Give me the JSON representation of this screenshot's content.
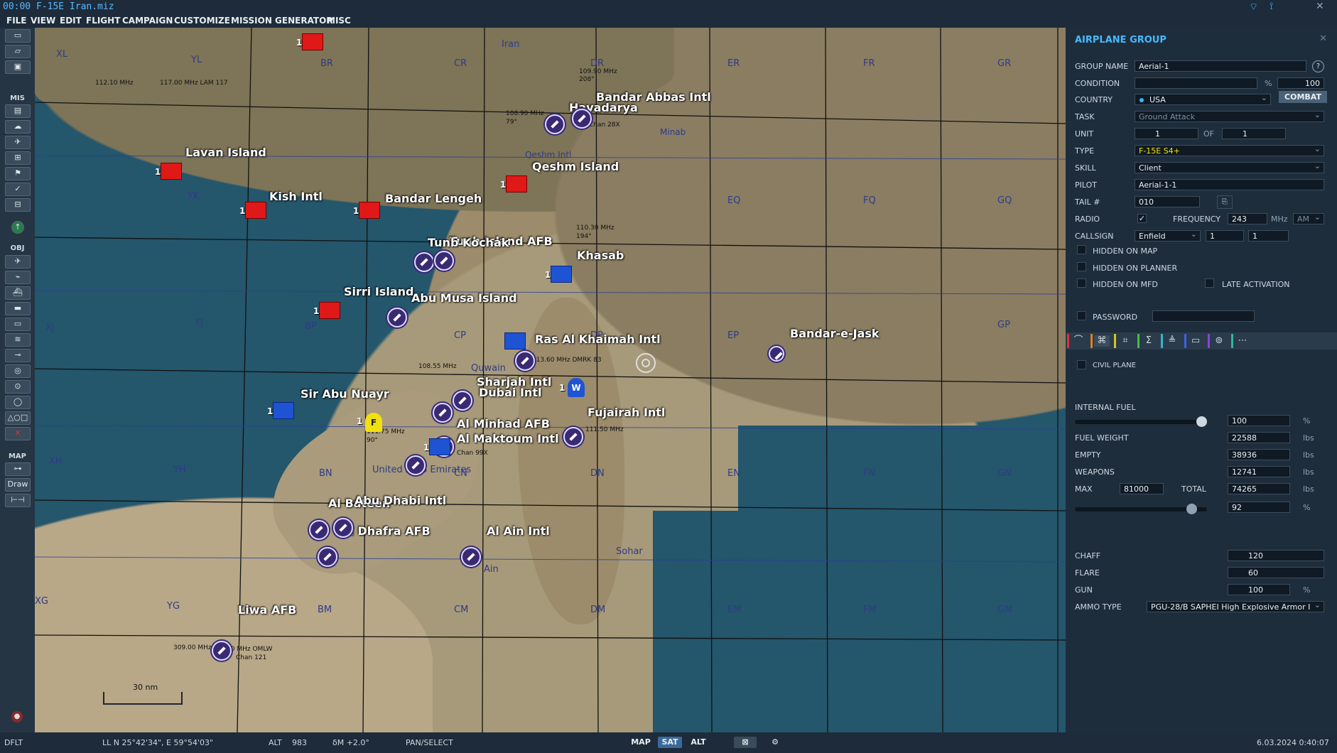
{
  "titlebar": {
    "title": "00:00 F-15E Iran.miz"
  },
  "menu": {
    "items": [
      "FILE",
      "VIEW",
      "EDIT",
      "FLIGHT",
      "CAMPAIGN",
      "CUSTOMIZE",
      "MISSION GENERATOR",
      "MISC"
    ]
  },
  "toolbar": {
    "sections": {
      "mis": "MIS",
      "obj": "OBJ",
      "map": "MAP"
    },
    "draw_label": "Draw"
  },
  "map": {
    "grid_labels": [
      "XL",
      "YL",
      "BR",
      "CR",
      "DR",
      "ER",
      "FR",
      "GR",
      "YK",
      "EQ",
      "FQ",
      "GQ",
      "XJ",
      "YJ",
      "BP",
      "CP",
      "DP",
      "EP",
      "FP",
      "GP",
      "XH",
      "YH",
      "BN",
      "CN",
      "DN",
      "EN",
      "FN",
      "GN",
      "XG",
      "YG",
      "ZG",
      "BM",
      "CM",
      "DM",
      "EM",
      "FM",
      "GM"
    ],
    "places": [
      {
        "name": "Bandar Abbas Intl"
      },
      {
        "name": "Havadarya"
      },
      {
        "name": "Lavan Island"
      },
      {
        "name": "Qeshm Island"
      },
      {
        "name": "Kish Intl"
      },
      {
        "name": "Bandar Lengeh"
      },
      {
        "name": "Tunb Island AFB"
      },
      {
        "name": "Tunb Kochak"
      },
      {
        "name": "Khasab"
      },
      {
        "name": "Sirri Island"
      },
      {
        "name": "Abu Musa Island"
      },
      {
        "name": "Ras Al Khaimah Intl"
      },
      {
        "name": "Bandar-e-Jask"
      },
      {
        "name": "Sharjah Intl"
      },
      {
        "name": "Dubai Intl"
      },
      {
        "name": "Sir Abu Nuayr"
      },
      {
        "name": "Fujairah Intl"
      },
      {
        "name": "Al Minhad AFB"
      },
      {
        "name": "Al Maktoum Intl"
      },
      {
        "name": "Al Bateen"
      },
      {
        "name": "Abu Dhabi Intl"
      },
      {
        "name": "Al Dhafra AFB"
      },
      {
        "name": "Al Ain Intl"
      },
      {
        "name": "Liwa AFB"
      }
    ],
    "small_texts": [
      "112.10 MHz",
      "117.00 MHz LAM 117",
      "109.90 MHz",
      "208°",
      "108.90 MHz",
      "79°",
      "Chan 28X",
      "Minab",
      "Qeshm Intl",
      "110.30 MHz",
      "194°",
      "113.60 MHz DMRK 83",
      "108.55 MHz",
      "111.50 MHz",
      "111.75 MHz",
      "90°",
      "Chan 99X",
      "309.00 MHz",
      "112.40 MHz OMLW",
      "Chan 121",
      "Iran",
      "United Arab Emirates",
      "Sohar",
      "Ain",
      "Quwain"
    ],
    "unit_labels": {
      "f": "F",
      "w": "W",
      "one": "1"
    },
    "scale_label": "30 nm"
  },
  "panel": {
    "title": "AIRPLANE GROUP",
    "labels": {
      "group_name": "GROUP NAME",
      "condition": "CONDITION",
      "country": "COUNTRY",
      "task": "TASK",
      "unit": "UNIT",
      "of": "OF",
      "type": "TYPE",
      "skill": "SKILL",
      "pilot": "PILOT",
      "tail": "TAIL #",
      "radio": "RADIO",
      "frequency": "FREQUENCY",
      "mhz": "MHz",
      "callsign": "CALLSIGN",
      "hidden_map": "HIDDEN ON MAP",
      "hidden_planner": "HIDDEN ON PLANNER",
      "hidden_mfd": "HIDDEN ON MFD",
      "late_activation": "LATE ACTIVATION",
      "password": "PASSWORD",
      "civil_plane": "CIVIL PLANE",
      "internal_fuel": "INTERNAL FUEL",
      "fuel_weight": "FUEL WEIGHT",
      "empty": "EMPTY",
      "weapons": "WEAPONS",
      "max": "MAX",
      "total": "TOTAL",
      "chaff": "CHAFF",
      "flare": "FLARE",
      "gun": "GUN",
      "ammo_type": "AMMO TYPE"
    },
    "values": {
      "group_name": "Aerial-1",
      "condition": "100",
      "country": "USA",
      "task": "Ground Attack",
      "unit": "1",
      "of": "1",
      "type": "F-15E S4+",
      "skill": "Client",
      "pilot": "Aerial-1-1",
      "tail": "010",
      "frequency": "243",
      "modulation": "AM",
      "callsign": "Enfield",
      "callsign_n1": "1",
      "callsign_n2": "1",
      "internal_fuel": "100",
      "fuel_weight": "22588",
      "empty": "38936",
      "weapons": "12741",
      "max": "81000",
      "total": "74265",
      "payload_pct": "92",
      "chaff": "120",
      "flare": "60",
      "gun": "100",
      "ammo_type": "PGU-28/B SAPHEI High Explosive Armor I"
    },
    "units": {
      "pct": "%",
      "lbs": "lbs"
    },
    "combat_label": "COMBAT",
    "fuel_fraction": 1.0,
    "payload_fraction": 0.92
  },
  "statusbar": {
    "mode": "DFLT",
    "coords": "LL   N 25°42'34\", E 59°54'03\"",
    "alt_label": "ALT",
    "alt_value": "983",
    "dm": "δM  +2.0°",
    "pan": "PAN/SELECT",
    "btn_map": "MAP",
    "btn_sat": "SAT",
    "btn_alt": "ALT",
    "datetime": "6.03.2024 0:40:07"
  },
  "colors": {
    "accent": "#47b9ff",
    "water": "#24566c",
    "red_coalition": "#e01818",
    "blue_coalition": "#1e54d4"
  }
}
